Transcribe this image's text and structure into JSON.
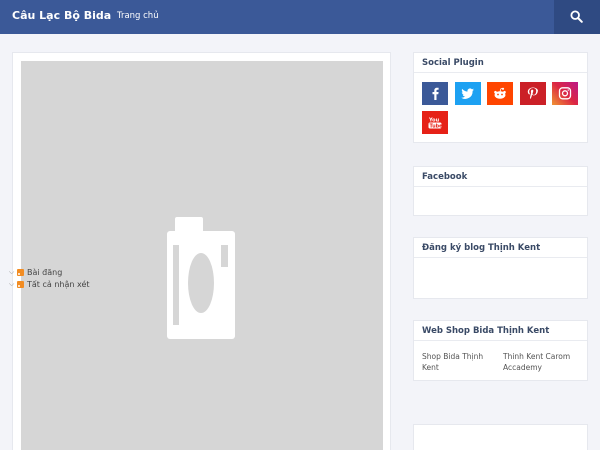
{
  "header": {
    "brand": "Câu Lạc Bộ Bida",
    "nav_home": "Trang chủ"
  },
  "main": {
    "image_placeholder_icon": "camera-icon"
  },
  "sidebar": {
    "social": {
      "title": "Social Plugin",
      "buttons": [
        {
          "name": "facebook",
          "color": "#3b5998"
        },
        {
          "name": "twitter",
          "color": "#1da1f2"
        },
        {
          "name": "reddit",
          "color": "#ff4500"
        },
        {
          "name": "pinterest",
          "color": "#cb2027"
        },
        {
          "name": "instagram",
          "color": "#c13584"
        },
        {
          "name": "youtube",
          "color": "#e62117"
        }
      ]
    },
    "facebook": {
      "title": "Facebook"
    },
    "subscribe": {
      "title": "Đăng ký blog Thịnh Kent",
      "items": [
        "Bài đăng",
        "Tất cả nhận xét"
      ]
    },
    "shop": {
      "title": "Web Shop Bida Thịnh Kent",
      "links": [
        "Shop Bida Thịnh Kent",
        "Thinh Kent Carom Accademy"
      ]
    }
  },
  "colors": {
    "header_bg": "#3b5998",
    "page_bg": "#f3f4f9",
    "placeholder_bg": "#d6d6d6"
  }
}
